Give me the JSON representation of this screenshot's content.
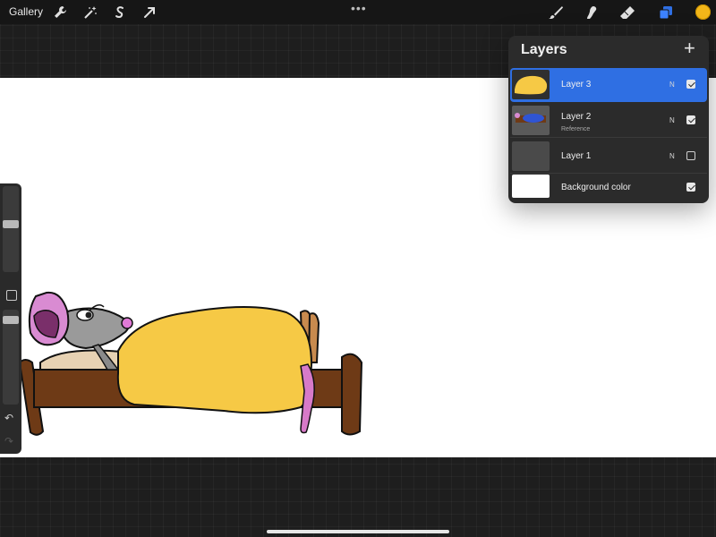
{
  "toolbar": {
    "gallery_label": "Gallery",
    "left_tools": [
      "wrench-icon",
      "magic-wand-icon",
      "selection-icon",
      "transform-arrow-icon"
    ],
    "center_menu": "•••",
    "right_tools": [
      "brush-icon",
      "smudge-icon",
      "eraser-icon",
      "layers-icon"
    ],
    "current_color": "#f2b619"
  },
  "layers_panel": {
    "title": "Layers",
    "add_label": "+",
    "layers": [
      {
        "name": "Layer 3",
        "sub": "",
        "blend": "N",
        "visible": true,
        "active": true
      },
      {
        "name": "Layer 2",
        "sub": "Reference",
        "blend": "N",
        "visible": true,
        "active": false
      },
      {
        "name": "Layer 1",
        "sub": "",
        "blend": "N",
        "visible": false,
        "active": false
      },
      {
        "name": "Background color",
        "sub": "",
        "blend": "",
        "visible": true,
        "active": false
      }
    ]
  },
  "sidebar": {
    "brush_size_level": 0.42,
    "opacity_level": 0.95,
    "undo_icon": "undo-icon",
    "redo_icon": "redo-icon"
  },
  "colors": {
    "accent": "#2f6fe3",
    "blanket": "#f6c945",
    "bed": "#6e3a16",
    "mouse_body": "#9a9a9a",
    "mouse_ear": "#d98bd2",
    "tail": "#d77ac8"
  }
}
